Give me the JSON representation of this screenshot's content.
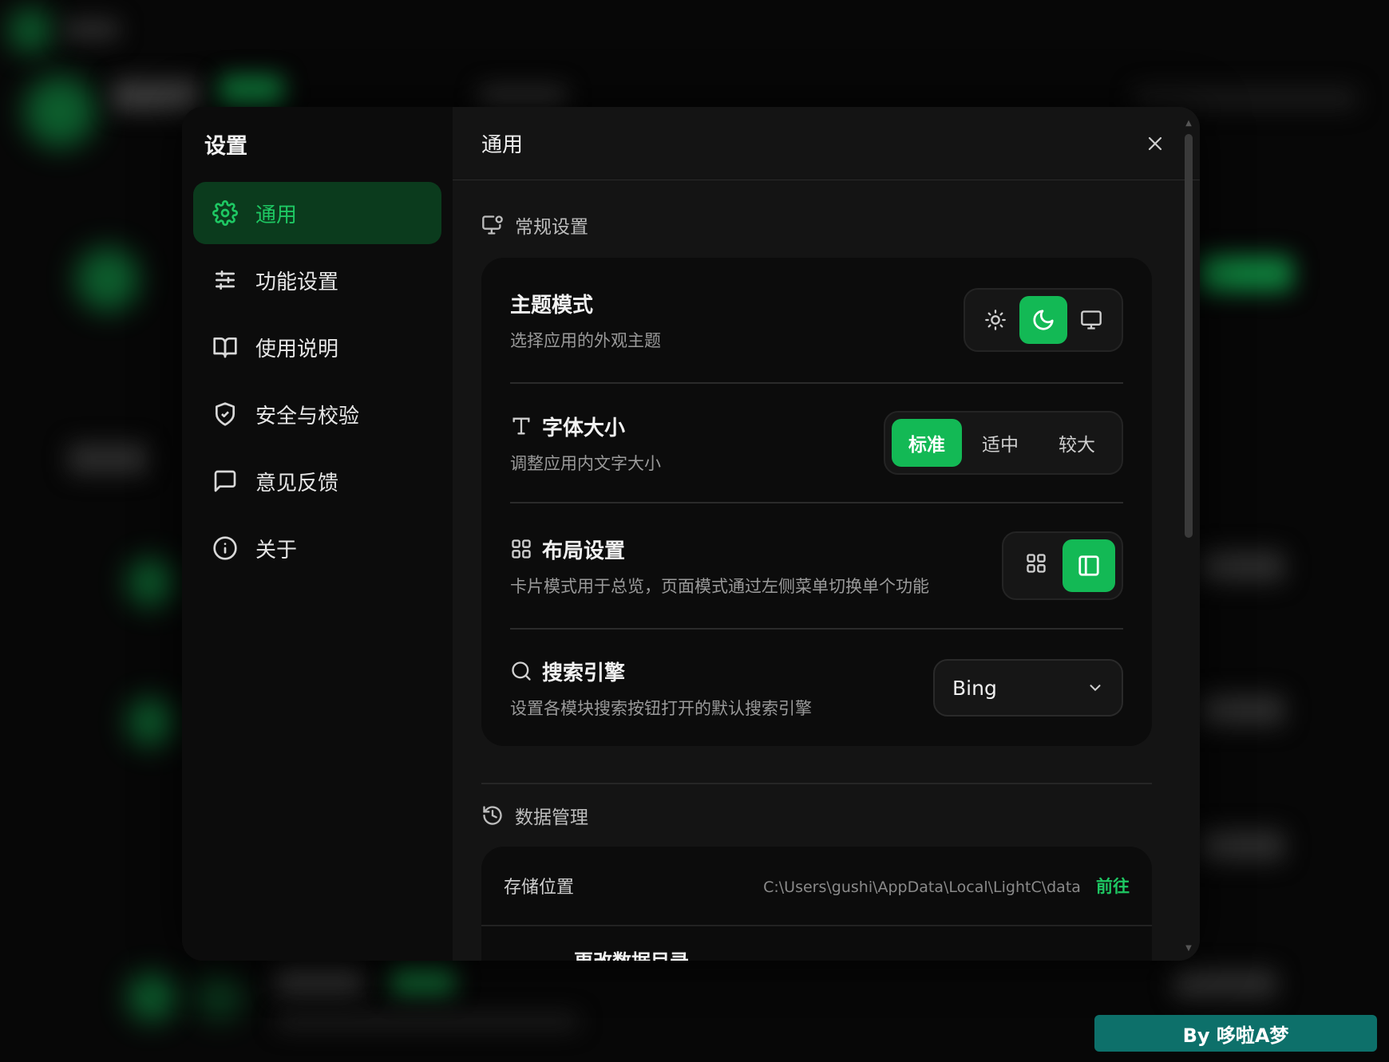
{
  "sidebar": {
    "title": "设置",
    "items": [
      {
        "label": "通用",
        "icon": "gear-icon"
      },
      {
        "label": "功能设置",
        "icon": "sliders-icon"
      },
      {
        "label": "使用说明",
        "icon": "book-icon"
      },
      {
        "label": "安全与校验",
        "icon": "shield-icon"
      },
      {
        "label": "意见反馈",
        "icon": "message-icon"
      },
      {
        "label": "关于",
        "icon": "info-icon"
      }
    ],
    "active_index": 0
  },
  "main": {
    "title": "通用",
    "general_section": {
      "heading": "常规设置",
      "theme": {
        "title": "主题模式",
        "desc": "选择应用的外观主题",
        "options": [
          "light-icon",
          "dark-icon",
          "system-icon"
        ],
        "selected": 1
      },
      "font_size": {
        "title": "字体大小",
        "desc": "调整应用内文字大小",
        "options": [
          "标准",
          "适中",
          "较大"
        ],
        "selected": 0
      },
      "layout": {
        "title": "布局设置",
        "desc": "卡片模式用于总览，页面模式通过左侧菜单切换单个功能",
        "options": [
          "grid-icon",
          "panel-icon"
        ],
        "selected": 1
      },
      "search_engine": {
        "title": "搜索引擎",
        "desc": "设置各模块搜索按钮打开的默认搜索引擎",
        "value": "Bing"
      }
    },
    "data_section": {
      "heading": "数据管理",
      "storage_label": "存储位置",
      "storage_path": "C:\\Users\\gushi\\AppData\\Local\\LightC\\data",
      "goto_label": "前往",
      "change_dir_label": "更改数据目录"
    }
  },
  "watermark": "By 哆啦A梦",
  "colors": {
    "accent": "#13b955",
    "accent_text": "#1ec863",
    "active_bg": "#0b3b1d"
  }
}
